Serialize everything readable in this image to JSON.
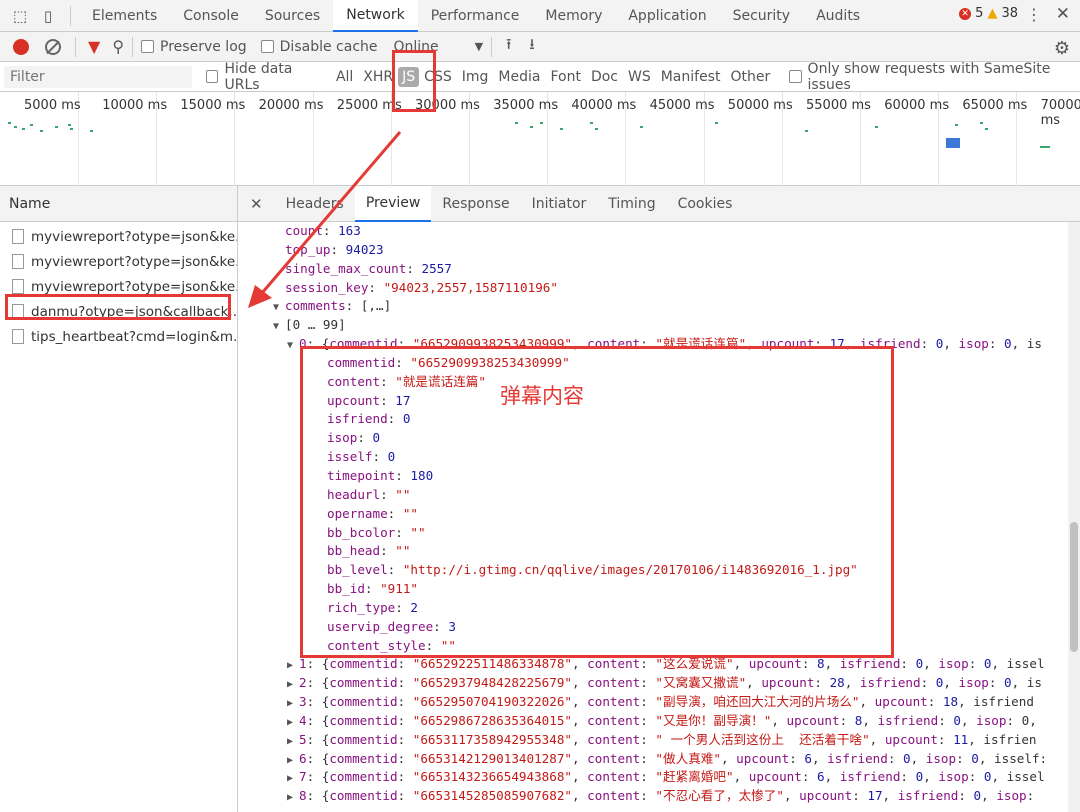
{
  "topbar": {
    "tabs": [
      "Elements",
      "Console",
      "Sources",
      "Network",
      "Performance",
      "Memory",
      "Application",
      "Security",
      "Audits"
    ],
    "active_tab": "Network",
    "errors": "5",
    "warnings": "38"
  },
  "toolbar": {
    "preserve_log": "Preserve log",
    "disable_cache": "Disable cache",
    "throttle": "Online"
  },
  "filterbar": {
    "placeholder": "Filter",
    "hide_data_urls": "Hide data URLs",
    "types": [
      "All",
      "XHR",
      "JS",
      "CSS",
      "Img",
      "Media",
      "Font",
      "Doc",
      "WS",
      "Manifest",
      "Other"
    ],
    "active_type": "JS",
    "samesite": "Only show requests with SameSite issues"
  },
  "timeline": {
    "ticks": [
      "5000 ms",
      "10000 ms",
      "15000 ms",
      "20000 ms",
      "25000 ms",
      "30000 ms",
      "35000 ms",
      "40000 ms",
      "45000 ms",
      "50000 ms",
      "55000 ms",
      "60000 ms",
      "65000 ms",
      "70000 ms"
    ]
  },
  "name_panel": {
    "header": "Name",
    "requests": [
      "myviewreport?otype=json&ke...",
      "myviewreport?otype=json&ke...",
      "myviewreport?otype=json&ke...",
      "danmu?otype=json&callback...",
      "tips_heartbeat?cmd=login&m..."
    ]
  },
  "detail": {
    "tabs": [
      "Headers",
      "Preview",
      "Response",
      "Initiator",
      "Timing",
      "Cookies"
    ],
    "active_tab": "Preview"
  },
  "annotation": "弹幕内容",
  "code_lines": [
    {
      "i": 0,
      "t": "",
      "segs": [
        [
          "k",
          "count"
        ],
        [
          "p",
          ": "
        ],
        [
          "n",
          "163"
        ]
      ]
    },
    {
      "i": 0,
      "t": "",
      "segs": [
        [
          "k",
          "top_up"
        ],
        [
          "p",
          ": "
        ],
        [
          "n",
          "94023"
        ]
      ]
    },
    {
      "i": 0,
      "t": "",
      "segs": [
        [
          "k",
          "single_max_count"
        ],
        [
          "p",
          ": "
        ],
        [
          "n",
          "2557"
        ]
      ]
    },
    {
      "i": 0,
      "t": "",
      "segs": [
        [
          "k",
          "session_key"
        ],
        [
          "p",
          ": "
        ],
        [
          "s",
          "\"94023,2557,1587110196\""
        ]
      ]
    },
    {
      "i": 0,
      "t": "▼",
      "segs": [
        [
          "k",
          "comments"
        ],
        [
          "p",
          ": [,…]"
        ]
      ]
    },
    {
      "i": 1,
      "t": "▼",
      "segs": [
        [
          "p",
          "[0 … 99]"
        ]
      ]
    },
    {
      "i": 2,
      "t": "▼",
      "segs": [
        [
          "k",
          "0"
        ],
        [
          "p",
          ": {"
        ],
        [
          "k",
          "commentid"
        ],
        [
          "p",
          ": "
        ],
        [
          "s",
          "\"6652909938253430999\""
        ],
        [
          "p",
          ", "
        ],
        [
          "k",
          "content"
        ],
        [
          "p",
          ": "
        ],
        [
          "s",
          "\"就是谎话连篇\""
        ],
        [
          "p",
          ", "
        ],
        [
          "k",
          "upcount"
        ],
        [
          "p",
          ": "
        ],
        [
          "n",
          "17"
        ],
        [
          "p",
          ", "
        ],
        [
          "k",
          "isfriend"
        ],
        [
          "p",
          ": "
        ],
        [
          "n",
          "0"
        ],
        [
          "p",
          ", "
        ],
        [
          "k",
          "isop"
        ],
        [
          "p",
          ": "
        ],
        [
          "n",
          "0"
        ],
        [
          "p",
          ", is"
        ]
      ]
    },
    {
      "i": 3,
      "t": "",
      "segs": [
        [
          "k",
          "commentid"
        ],
        [
          "p",
          ": "
        ],
        [
          "s",
          "\"6652909938253430999\""
        ]
      ]
    },
    {
      "i": 3,
      "t": "",
      "segs": [
        [
          "k",
          "content"
        ],
        [
          "p",
          ": "
        ],
        [
          "s",
          "\"就是谎话连篇\""
        ]
      ]
    },
    {
      "i": 3,
      "t": "",
      "segs": [
        [
          "k",
          "upcount"
        ],
        [
          "p",
          ": "
        ],
        [
          "n",
          "17"
        ]
      ]
    },
    {
      "i": 3,
      "t": "",
      "segs": [
        [
          "k",
          "isfriend"
        ],
        [
          "p",
          ": "
        ],
        [
          "n",
          "0"
        ]
      ]
    },
    {
      "i": 3,
      "t": "",
      "segs": [
        [
          "k",
          "isop"
        ],
        [
          "p",
          ": "
        ],
        [
          "n",
          "0"
        ]
      ]
    },
    {
      "i": 3,
      "t": "",
      "segs": [
        [
          "k",
          "isself"
        ],
        [
          "p",
          ": "
        ],
        [
          "n",
          "0"
        ]
      ]
    },
    {
      "i": 3,
      "t": "",
      "segs": [
        [
          "k",
          "timepoint"
        ],
        [
          "p",
          ": "
        ],
        [
          "n",
          "180"
        ]
      ]
    },
    {
      "i": 3,
      "t": "",
      "segs": [
        [
          "k",
          "headurl"
        ],
        [
          "p",
          ": "
        ],
        [
          "s",
          "\"\""
        ]
      ]
    },
    {
      "i": 3,
      "t": "",
      "segs": [
        [
          "k",
          "opername"
        ],
        [
          "p",
          ": "
        ],
        [
          "s",
          "\"\""
        ]
      ]
    },
    {
      "i": 3,
      "t": "",
      "segs": [
        [
          "k",
          "bb_bcolor"
        ],
        [
          "p",
          ": "
        ],
        [
          "s",
          "\"\""
        ]
      ]
    },
    {
      "i": 3,
      "t": "",
      "segs": [
        [
          "k",
          "bb_head"
        ],
        [
          "p",
          ": "
        ],
        [
          "s",
          "\"\""
        ]
      ]
    },
    {
      "i": 3,
      "t": "",
      "segs": [
        [
          "k",
          "bb_level"
        ],
        [
          "p",
          ": "
        ],
        [
          "s",
          "\"http://i.gtimg.cn/qqlive/images/20170106/i1483692016_1.jpg\""
        ]
      ]
    },
    {
      "i": 3,
      "t": "",
      "segs": [
        [
          "k",
          "bb_id"
        ],
        [
          "p",
          ": "
        ],
        [
          "s",
          "\"911\""
        ]
      ]
    },
    {
      "i": 3,
      "t": "",
      "segs": [
        [
          "k",
          "rich_type"
        ],
        [
          "p",
          ": "
        ],
        [
          "n",
          "2"
        ]
      ]
    },
    {
      "i": 3,
      "t": "",
      "segs": [
        [
          "k",
          "uservip_degree"
        ],
        [
          "p",
          ": "
        ],
        [
          "n",
          "3"
        ]
      ]
    },
    {
      "i": 3,
      "t": "",
      "segs": [
        [
          "k",
          "content_style"
        ],
        [
          "p",
          ": "
        ],
        [
          "s",
          "\"\""
        ]
      ]
    },
    {
      "i": 2,
      "t": "▶",
      "segs": [
        [
          "k",
          "1"
        ],
        [
          "p",
          ": {"
        ],
        [
          "k",
          "commentid"
        ],
        [
          "p",
          ": "
        ],
        [
          "s",
          "\"6652922511486334878\""
        ],
        [
          "p",
          ", "
        ],
        [
          "k",
          "content"
        ],
        [
          "p",
          ": "
        ],
        [
          "s",
          "\"这么爱说谎\""
        ],
        [
          "p",
          ", "
        ],
        [
          "k",
          "upcount"
        ],
        [
          "p",
          ": "
        ],
        [
          "n",
          "8"
        ],
        [
          "p",
          ", "
        ],
        [
          "k",
          "isfriend"
        ],
        [
          "p",
          ": "
        ],
        [
          "n",
          "0"
        ],
        [
          "p",
          ", "
        ],
        [
          "k",
          "isop"
        ],
        [
          "p",
          ": "
        ],
        [
          "n",
          "0"
        ],
        [
          "p",
          ", issel"
        ]
      ]
    },
    {
      "i": 2,
      "t": "▶",
      "segs": [
        [
          "k",
          "2"
        ],
        [
          "p",
          ": {"
        ],
        [
          "k",
          "commentid"
        ],
        [
          "p",
          ": "
        ],
        [
          "s",
          "\"6652937948428225679\""
        ],
        [
          "p",
          ", "
        ],
        [
          "k",
          "content"
        ],
        [
          "p",
          ": "
        ],
        [
          "s",
          "\"又窝囊又撒谎\""
        ],
        [
          "p",
          ", "
        ],
        [
          "k",
          "upcount"
        ],
        [
          "p",
          ": "
        ],
        [
          "n",
          "28"
        ],
        [
          "p",
          ", "
        ],
        [
          "k",
          "isfriend"
        ],
        [
          "p",
          ": "
        ],
        [
          "n",
          "0"
        ],
        [
          "p",
          ", "
        ],
        [
          "k",
          "isop"
        ],
        [
          "p",
          ": "
        ],
        [
          "n",
          "0"
        ],
        [
          "p",
          ", is"
        ]
      ]
    },
    {
      "i": 2,
      "t": "▶",
      "segs": [
        [
          "k",
          "3"
        ],
        [
          "p",
          ": {"
        ],
        [
          "k",
          "commentid"
        ],
        [
          "p",
          ": "
        ],
        [
          "s",
          "\"6652950704190322026\""
        ],
        [
          "p",
          ", "
        ],
        [
          "k",
          "content"
        ],
        [
          "p",
          ": "
        ],
        [
          "s",
          "\"副导演，咱还回大江大河的片场么\""
        ],
        [
          "p",
          ", "
        ],
        [
          "k",
          "upcount"
        ],
        [
          "p",
          ": "
        ],
        [
          "n",
          "18"
        ],
        [
          "p",
          ", isfriend"
        ]
      ]
    },
    {
      "i": 2,
      "t": "▶",
      "segs": [
        [
          "k",
          "4"
        ],
        [
          "p",
          ": {"
        ],
        [
          "k",
          "commentid"
        ],
        [
          "p",
          ": "
        ],
        [
          "s",
          "\"6652986728635364015\""
        ],
        [
          "p",
          ", "
        ],
        [
          "k",
          "content"
        ],
        [
          "p",
          ": "
        ],
        [
          "s",
          "\"又是你！副导演！\""
        ],
        [
          "p",
          ", "
        ],
        [
          "k",
          "upcount"
        ],
        [
          "p",
          ": "
        ],
        [
          "n",
          "8"
        ],
        [
          "p",
          ", "
        ],
        [
          "k",
          "isfriend"
        ],
        [
          "p",
          ": "
        ],
        [
          "n",
          "0"
        ],
        [
          "p",
          ", "
        ],
        [
          "k",
          "isop"
        ],
        [
          "p",
          ": 0,"
        ]
      ]
    },
    {
      "i": 2,
      "t": "▶",
      "segs": [
        [
          "k",
          "5"
        ],
        [
          "p",
          ": {"
        ],
        [
          "k",
          "commentid"
        ],
        [
          "p",
          ": "
        ],
        [
          "s",
          "\"6653117358942955348\""
        ],
        [
          "p",
          ", "
        ],
        [
          "k",
          "content"
        ],
        [
          "p",
          ": "
        ],
        [
          "s",
          "\" 一个男人活到这份上  还活着干啥\""
        ],
        [
          "p",
          ", "
        ],
        [
          "k",
          "upcount"
        ],
        [
          "p",
          ": "
        ],
        [
          "n",
          "11"
        ],
        [
          "p",
          ", isfrien"
        ]
      ]
    },
    {
      "i": 2,
      "t": "▶",
      "segs": [
        [
          "k",
          "6"
        ],
        [
          "p",
          ": {"
        ],
        [
          "k",
          "commentid"
        ],
        [
          "p",
          ": "
        ],
        [
          "s",
          "\"6653142129013401287\""
        ],
        [
          "p",
          ", "
        ],
        [
          "k",
          "content"
        ],
        [
          "p",
          ": "
        ],
        [
          "s",
          "\"做人真难\""
        ],
        [
          "p",
          ", "
        ],
        [
          "k",
          "upcount"
        ],
        [
          "p",
          ": "
        ],
        [
          "n",
          "6"
        ],
        [
          "p",
          ", "
        ],
        [
          "k",
          "isfriend"
        ],
        [
          "p",
          ": "
        ],
        [
          "n",
          "0"
        ],
        [
          "p",
          ", "
        ],
        [
          "k",
          "isop"
        ],
        [
          "p",
          ": "
        ],
        [
          "n",
          "0"
        ],
        [
          "p",
          ", isself:"
        ]
      ]
    },
    {
      "i": 2,
      "t": "▶",
      "segs": [
        [
          "k",
          "7"
        ],
        [
          "p",
          ": {"
        ],
        [
          "k",
          "commentid"
        ],
        [
          "p",
          ": "
        ],
        [
          "s",
          "\"6653143236654943868\""
        ],
        [
          "p",
          ", "
        ],
        [
          "k",
          "content"
        ],
        [
          "p",
          ": "
        ],
        [
          "s",
          "\"赶紧离婚吧\""
        ],
        [
          "p",
          ", "
        ],
        [
          "k",
          "upcount"
        ],
        [
          "p",
          ": "
        ],
        [
          "n",
          "6"
        ],
        [
          "p",
          ", "
        ],
        [
          "k",
          "isfriend"
        ],
        [
          "p",
          ": "
        ],
        [
          "n",
          "0"
        ],
        [
          "p",
          ", "
        ],
        [
          "k",
          "isop"
        ],
        [
          "p",
          ": "
        ],
        [
          "n",
          "0"
        ],
        [
          "p",
          ", issel"
        ]
      ]
    },
    {
      "i": 2,
      "t": "▶",
      "segs": [
        [
          "k",
          "8"
        ],
        [
          "p",
          ": {"
        ],
        [
          "k",
          "commentid"
        ],
        [
          "p",
          ": "
        ],
        [
          "s",
          "\"6653145285085907682\""
        ],
        [
          "p",
          ", "
        ],
        [
          "k",
          "content"
        ],
        [
          "p",
          ": "
        ],
        [
          "s",
          "\"不忍心看了，太惨了\""
        ],
        [
          "p",
          ", "
        ],
        [
          "k",
          "upcount"
        ],
        [
          "p",
          ": "
        ],
        [
          "n",
          "17"
        ],
        [
          "p",
          ", "
        ],
        [
          "k",
          "isfriend"
        ],
        [
          "p",
          ": "
        ],
        [
          "n",
          "0"
        ],
        [
          "p",
          ", "
        ],
        [
          "k",
          "isop"
        ],
        [
          "p",
          ":"
        ]
      ]
    }
  ]
}
